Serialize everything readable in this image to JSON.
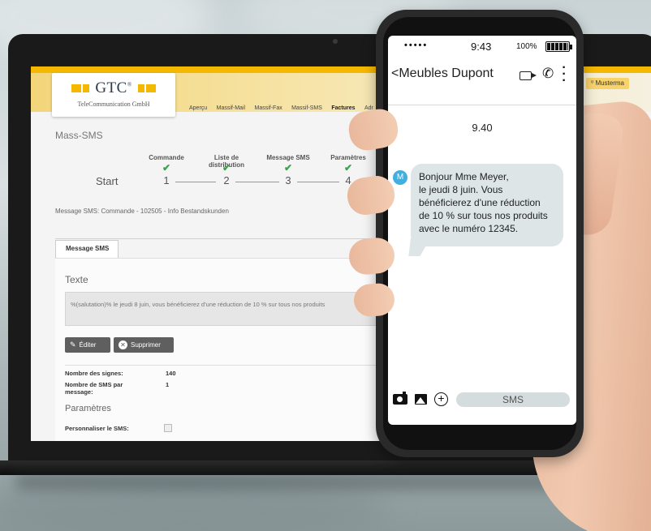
{
  "laptop": {
    "logo": {
      "brand": "GTC",
      "registered": "®",
      "subtitle": "TeleCommunication GmbH"
    },
    "nav": [
      "Aperçu",
      "Massif-Mail",
      "Massif-Fax",
      "Massif-SMS",
      "Factures",
      "Adr"
    ],
    "nav_active_index": 4,
    "user_chip": "Musterma",
    "page_title": "Mass-SMS",
    "stepper": {
      "start_label": "Start",
      "steps": [
        {
          "label": "Commande",
          "number": "1",
          "done": true
        },
        {
          "label": "Liste de distribution",
          "number": "2",
          "done": true
        },
        {
          "label": "Message SMS",
          "number": "3",
          "done": true
        },
        {
          "label": "Paramètres",
          "number": "4",
          "done": true
        }
      ]
    },
    "breadcrumb": "Message SMS: Commande - 102505 - Info Bestandskunden",
    "tab": "Message SMS",
    "texte_heading": "Texte",
    "message_text": "%(salutation)% le jeudi 8 juin, vous bénéficierez d'une réduction de 10 % sur tous nos produits",
    "buttons": {
      "edit": "Éditer",
      "delete": "Supprimer"
    },
    "fields": [
      {
        "label": "Nombre des signes:",
        "value": "140"
      },
      {
        "label": "Nombre de SMS par message:",
        "value": "1"
      }
    ],
    "params_heading": "Paramètres",
    "personalize_label": "Personnaliser le SMS:",
    "personalize_checked": false
  },
  "phone": {
    "status": {
      "signal": "•••••",
      "time": "9:43",
      "battery": "100%"
    },
    "contact_name": "<Meubles Dupont",
    "date": "9.40",
    "avatar_initial": "M",
    "message_lines": [
      "Bonjour Mme Meyer,",
      "le jeudi 8 juin. Vous",
      "bénéficierez d'une réduction",
      "de 10 % sur tous nos produits",
      "avec le numéro 12345."
    ],
    "composer_button": "SMS",
    "colors": {
      "avatar": "#3fb0e0",
      "bubble": "#dde5e6"
    }
  }
}
